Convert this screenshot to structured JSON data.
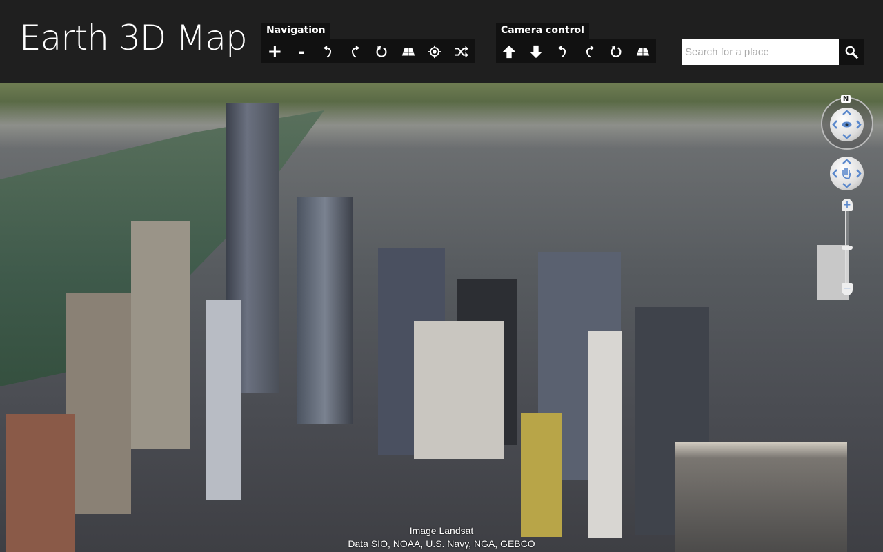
{
  "header": {
    "title": "Earth 3D Map"
  },
  "navigation": {
    "label": "Navigation",
    "buttons": [
      {
        "name": "zoom-in",
        "icon": "plus-icon"
      },
      {
        "name": "zoom-out",
        "icon": "minus-icon"
      },
      {
        "name": "rotate-left",
        "icon": "rotate-left-icon"
      },
      {
        "name": "rotate-right",
        "icon": "rotate-right-icon"
      },
      {
        "name": "reset",
        "icon": "reset-icon"
      },
      {
        "name": "tilt",
        "icon": "tilt-icon"
      },
      {
        "name": "locate",
        "icon": "target-icon"
      },
      {
        "name": "random",
        "icon": "shuffle-icon"
      }
    ]
  },
  "camera": {
    "label": "Camera control",
    "buttons": [
      {
        "name": "up",
        "icon": "arrow-up-icon"
      },
      {
        "name": "down",
        "icon": "arrow-down-icon"
      },
      {
        "name": "rotate-left",
        "icon": "rotate-left-icon"
      },
      {
        "name": "rotate-right",
        "icon": "rotate-right-icon"
      },
      {
        "name": "reset",
        "icon": "reset-icon"
      },
      {
        "name": "tilt",
        "icon": "tilt-icon"
      }
    ]
  },
  "search": {
    "placeholder": "Search for a place",
    "value": ""
  },
  "map_controls": {
    "compass_label": "N",
    "zoom_level_percent": 50
  },
  "attribution": {
    "line1": "Image Landsat",
    "line2": "Data SIO, NOAA, U.S. Navy, NGA, GEBCO"
  }
}
